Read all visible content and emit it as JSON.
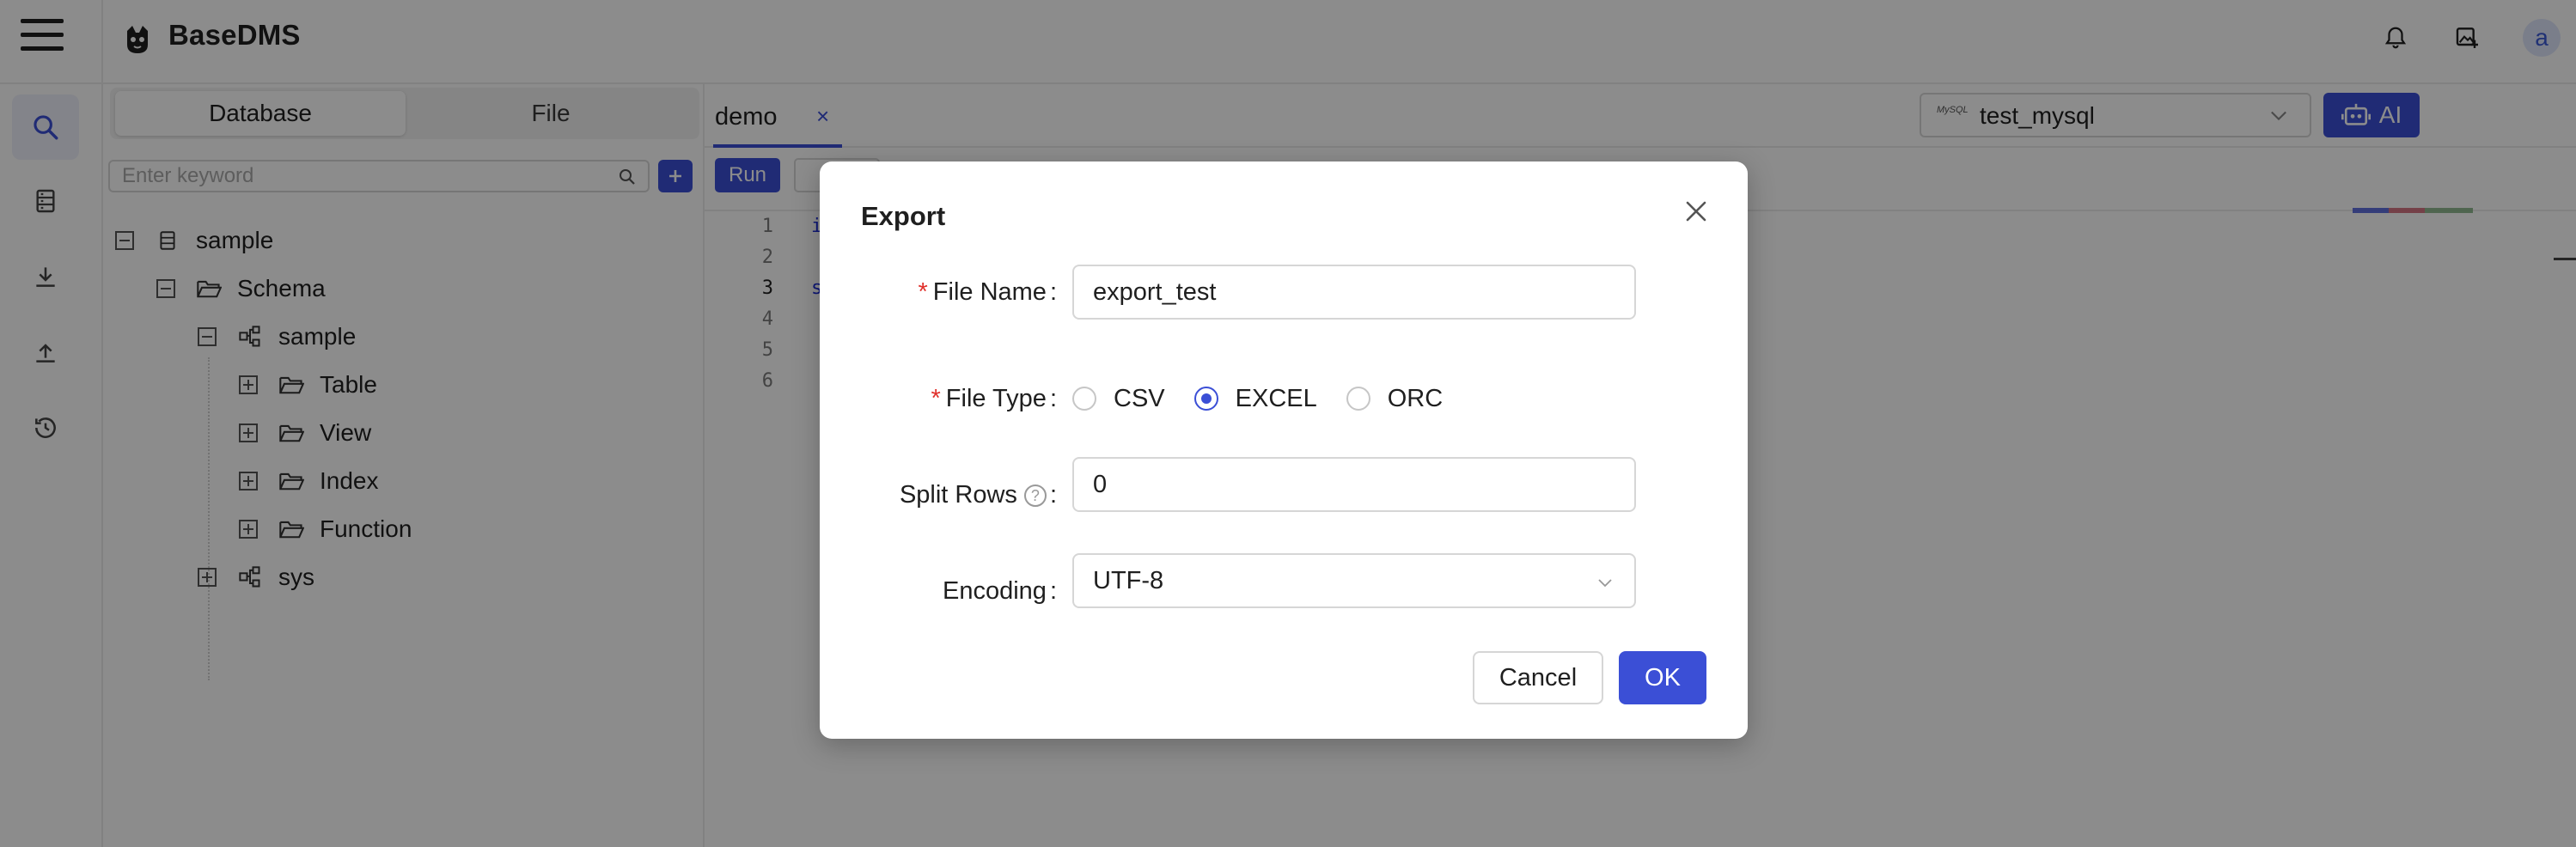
{
  "header": {
    "app_title": "BaseDMS",
    "avatar_initial": "a"
  },
  "sidebar": {
    "tabs": [
      {
        "label": "Database",
        "active": true
      },
      {
        "label": "File",
        "active": false
      }
    ],
    "search_placeholder": "Enter keyword",
    "tree": [
      {
        "label": "sample",
        "level": 0,
        "icon": "database-icon",
        "expanded": true
      },
      {
        "label": "Schema",
        "level": 1,
        "icon": "folder-icon",
        "expanded": true
      },
      {
        "label": "sample",
        "level": 2,
        "icon": "schema-icon",
        "expanded": true
      },
      {
        "label": "Table",
        "level": 3,
        "icon": "folder-icon",
        "expanded": false
      },
      {
        "label": "View",
        "level": 3,
        "icon": "folder-icon",
        "expanded": false
      },
      {
        "label": "Index",
        "level": 3,
        "icon": "folder-icon",
        "expanded": false
      },
      {
        "label": "Function",
        "level": 3,
        "icon": "folder-icon",
        "expanded": false
      },
      {
        "label": "sys",
        "level": 2,
        "icon": "schema-icon",
        "expanded": false
      }
    ]
  },
  "editor": {
    "tab_label": "demo",
    "tab_close": "×",
    "datasource": {
      "badge": "MySQL",
      "value": "test_mysql"
    },
    "ai_label": "AI",
    "run_label": "Run",
    "line_numbers": [
      "1",
      "2",
      "3",
      "4",
      "5",
      "6"
    ],
    "code_fragments": [
      "i",
      "s"
    ]
  },
  "dialog": {
    "title": "Export",
    "file_name": {
      "label": "File Name",
      "value": "export_test",
      "required": true
    },
    "file_type": {
      "label": "File Type",
      "required": true,
      "options": [
        {
          "label": "CSV",
          "selected": false
        },
        {
          "label": "EXCEL",
          "selected": true
        },
        {
          "label": "ORC",
          "selected": false
        }
      ]
    },
    "split_rows": {
      "label": "Split Rows",
      "value": "0",
      "help": "?"
    },
    "encoding": {
      "label": "Encoding",
      "value": "UTF-8"
    },
    "cancel_label": "Cancel",
    "ok_label": "OK"
  },
  "colors": {
    "accent": "#3b4fd6",
    "required": "#e0302b",
    "overlay": "rgba(0,0,0,0.45)"
  }
}
